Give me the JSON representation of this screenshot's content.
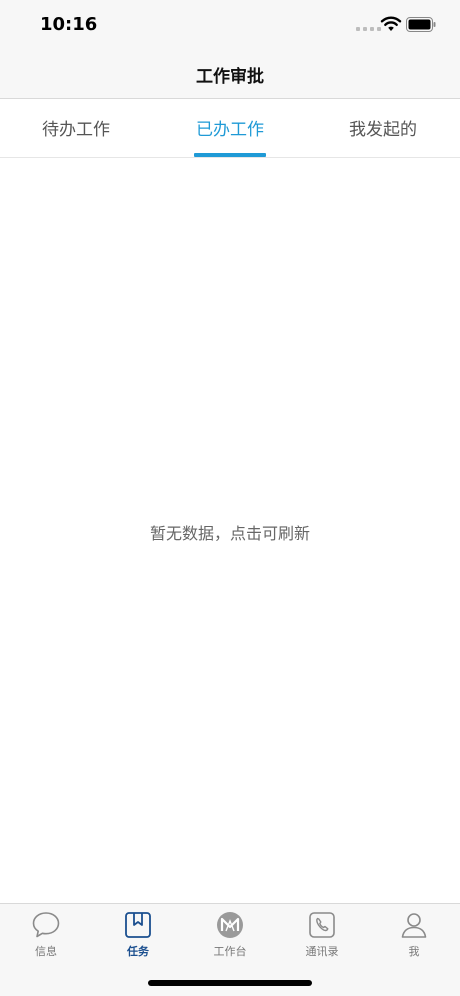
{
  "status_bar": {
    "time": "10:16"
  },
  "nav": {
    "title": "工作审批"
  },
  "tabs": [
    {
      "label": "待办工作",
      "active": false
    },
    {
      "label": "已办工作",
      "active": true
    },
    {
      "label": "我发起的",
      "active": false
    }
  ],
  "empty_state": {
    "message": "暂无数据，点击可刷新"
  },
  "tab_bar": {
    "items": [
      {
        "label": "信息",
        "icon": "chat-bubble-icon",
        "active": false
      },
      {
        "label": "任务",
        "icon": "bookmark-icon",
        "active": true
      },
      {
        "label": "工作台",
        "icon": "logo-m-icon",
        "active": false
      },
      {
        "label": "通讯录",
        "icon": "phone-icon",
        "active": false
      },
      {
        "label": "我",
        "icon": "person-icon",
        "active": false
      }
    ]
  },
  "colors": {
    "accent": "#1f9ad6",
    "active_tab_bar": "#1b4f8f"
  }
}
